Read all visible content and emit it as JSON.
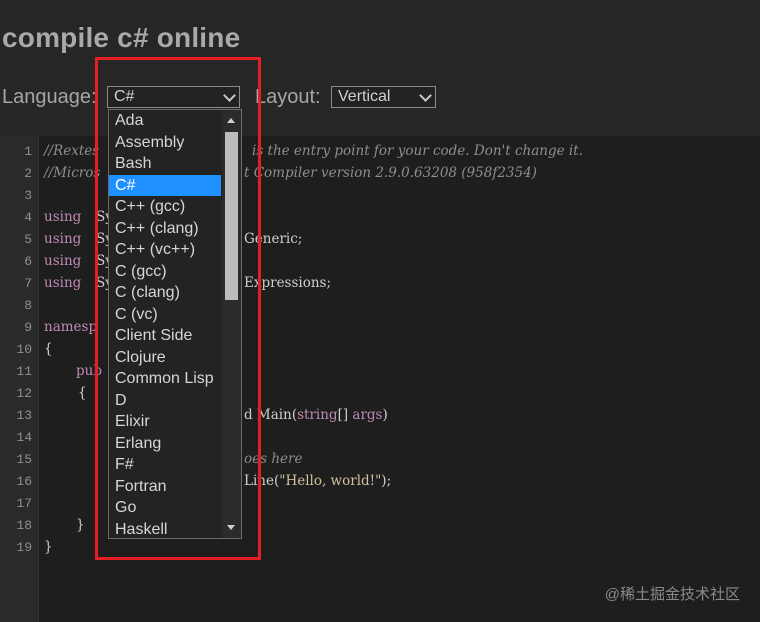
{
  "header": {
    "title": "compile c# online",
    "language_label": "Language:",
    "language_value": "C#",
    "layout_label": "Layout:",
    "layout_value": "Vertical"
  },
  "editor": {
    "line_numbers": [
      "1",
      "2",
      "3",
      "4",
      "5",
      "6",
      "7",
      "8",
      "9",
      "10",
      "11",
      "12",
      "13",
      "14",
      "15",
      "16",
      "17",
      "18",
      "19"
    ],
    "line1_comment": "//Rextes",
    "line1_tail": "is the entry point for your code. Don't change it.",
    "line2_comment": "//Micros",
    "line2_tail": "t Compiler version 2.9.0.63208 (958f2354)",
    "using_kw": "using",
    "sy": "Sy",
    "line5_tail": "Generic;",
    "line7_tail": "Expressions;",
    "namespace_partial": "namesp",
    "brace_open": "{",
    "pub_partial": "pub",
    "main_sig_prefix": "d Main(",
    "string_kw": "string",
    "main_sig_mid": "[] ",
    "args": "args",
    "main_sig_suffix": ")",
    "goes_here": "oes here",
    "writeline_prefix": "Line(",
    "hello_str": "\"Hello, world!\"",
    "writeline_suffix": ");",
    "brace_close": "}"
  },
  "dropdown": {
    "options": [
      "Ada",
      "Assembly",
      "Bash",
      "C#",
      "C++ (gcc)",
      "C++ (clang)",
      "C++ (vc++)",
      "C (gcc)",
      "C (clang)",
      "C (vc)",
      "Client Side",
      "Clojure",
      "Common Lisp",
      "D",
      "Elixir",
      "Erlang",
      "F#",
      "Fortran",
      "Go",
      "Haskell"
    ],
    "selected": "C#"
  },
  "watermark": "@稀土掘金技术社区",
  "colors": {
    "selected_option_bg": "#1e90ff",
    "highlight_border": "#e51e26",
    "background": "#1e1e1e"
  }
}
